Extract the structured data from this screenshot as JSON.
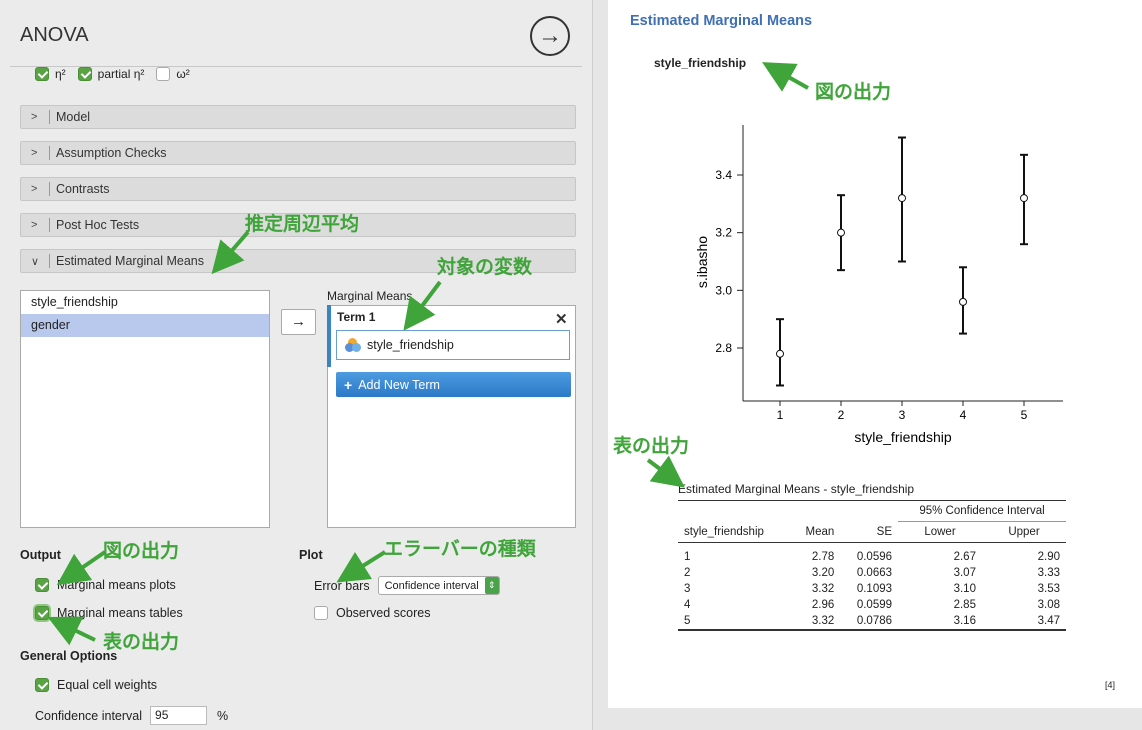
{
  "left": {
    "title": "ANOVA",
    "effect_sizes": [
      {
        "label": "η²",
        "checked": true
      },
      {
        "label": "partial η²",
        "checked": true
      },
      {
        "label": "ω²",
        "checked": false
      }
    ],
    "sections": [
      {
        "chevron": ">",
        "label": "Model"
      },
      {
        "chevron": ">",
        "label": "Assumption Checks"
      },
      {
        "chevron": ">",
        "label": "Contrasts"
      },
      {
        "chevron": ">",
        "label": "Post Hoc Tests"
      },
      {
        "chevron": "∨",
        "label": "Estimated Marginal Means"
      }
    ],
    "variables": [
      "style_friendship",
      "gender"
    ],
    "move_arrow": "→",
    "marginal_means_label": "Marginal Means",
    "term_title": "Term 1",
    "term_close": "✕",
    "term_variable": "style_friendship",
    "add_term": "Add New Term",
    "add_term_icon": "+",
    "output_header": "Output",
    "plot_header": "Plot",
    "marginal_plots_label": "Marginal means plots",
    "marginal_tables_label": "Marginal means tables",
    "error_bars_label": "Error bars",
    "error_bars_value": "Confidence interval",
    "observed_scores_label": "Observed scores",
    "general_header": "General Options",
    "equal_weights_label": "Equal cell weights",
    "ci_label": "Confidence interval",
    "ci_value": "95",
    "ci_unit": "%"
  },
  "annotations": {
    "emm": "推定周辺平均",
    "target_var": "対象の変数",
    "fig_output": "図の出力",
    "table_output": "表の出力",
    "error_type": "エラーバーの種類"
  },
  "results": {
    "section_title": "Estimated Marginal Means",
    "plot_title": "style_friendship",
    "table_title": "Estimated Marginal Means - style_friendship",
    "ci_header": "95% Confidence Interval",
    "columns": [
      "style_friendship",
      "Mean",
      "SE",
      "Lower",
      "Upper"
    ],
    "rows": [
      [
        "1",
        "2.78",
        "0.0596",
        "2.67",
        "2.90"
      ],
      [
        "2",
        "3.20",
        "0.0663",
        "3.07",
        "3.33"
      ],
      [
        "3",
        "3.32",
        "0.1093",
        "3.10",
        "3.53"
      ],
      [
        "4",
        "2.96",
        "0.0599",
        "2.85",
        "3.08"
      ],
      [
        "5",
        "3.32",
        "0.0786",
        "3.16",
        "3.47"
      ]
    ],
    "footnote": "[4]"
  },
  "chart_data": {
    "type": "scatter",
    "title": "style_friendship",
    "xlabel": "style_friendship",
    "ylabel": "s.ibasho",
    "categories": [
      "1",
      "2",
      "3",
      "4",
      "5"
    ],
    "values": [
      2.78,
      3.2,
      3.32,
      2.96,
      3.32
    ],
    "lower": [
      2.67,
      3.07,
      3.1,
      2.85,
      3.16
    ],
    "upper": [
      2.9,
      3.33,
      3.53,
      3.08,
      3.47
    ],
    "yticks": [
      "2.8",
      "3.0",
      "3.2",
      "3.4"
    ],
    "ylim": [
      2.6,
      3.6
    ],
    "error_bars": "Confidence interval",
    "grid": false
  }
}
